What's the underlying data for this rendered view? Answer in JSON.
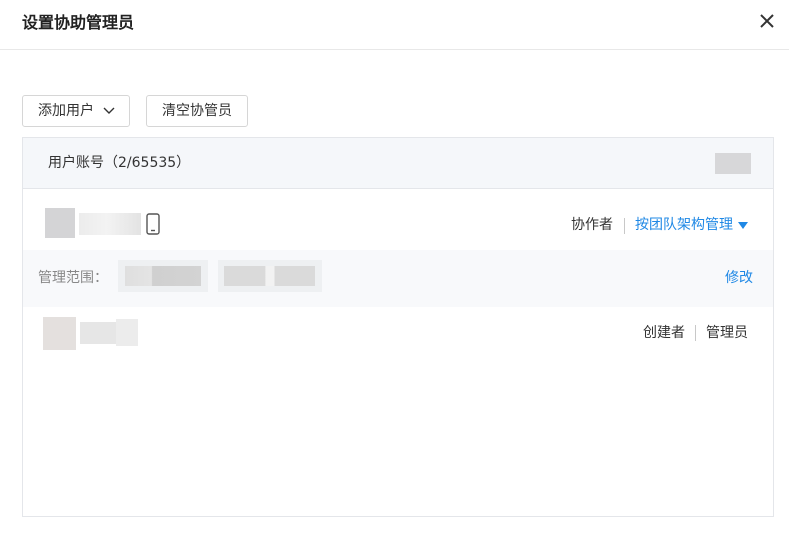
{
  "dialog": {
    "title": "设置协助管理员"
  },
  "toolbar": {
    "add_user_label": "添加用户",
    "clear_label": "清空协管员"
  },
  "table": {
    "header_label": "用户账号（2/65535）",
    "rows": [
      {
        "role": "协作者",
        "scope_mode": "按团队架构管理",
        "scope_label": "管理范围：",
        "edit_label": "修改"
      },
      {
        "role": "创建者",
        "role2": "管理员"
      }
    ]
  },
  "icons": {
    "close": "close-icon",
    "dropdown": "chevron-down-icon",
    "phone": "mobile-phone-icon",
    "triangle": "caret-down-icon"
  },
  "colors": {
    "link": "#1f88e5",
    "header_bg": "#f5f7fa",
    "scope_bg": "#f8f9fb"
  }
}
